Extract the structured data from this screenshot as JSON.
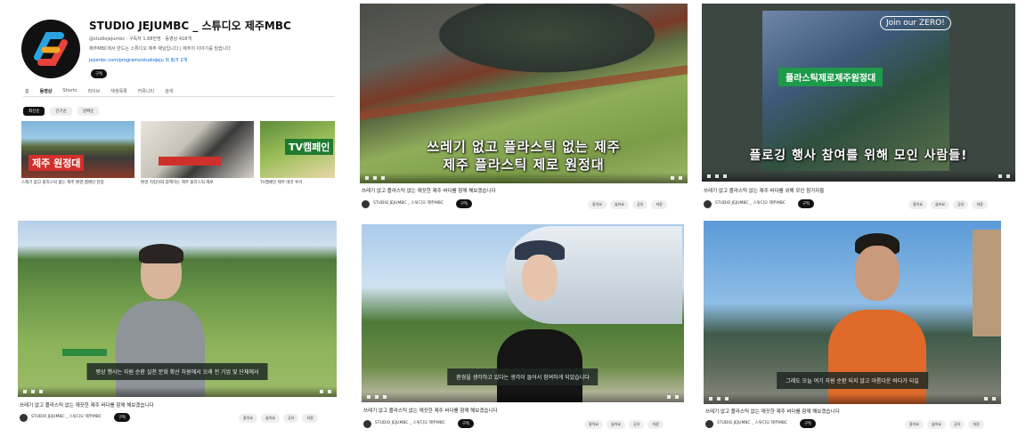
{
  "channel": {
    "name": "STUDIO JEJUMBC _ 스튜디오 제주MBC",
    "handle": "@studiojejumbc · 구독자 1.68만명 · 동영상 418개",
    "desc": "제주MBC에서 만드는 스튜디오 제주 채널입니다 | 제주의 이야기를 담습니다",
    "link": "jejumbc.com/programs/studiojeju 외 링크 2개",
    "subscribe": "구독",
    "tabs": [
      "홈",
      "동영상",
      "Shorts",
      "라이브",
      "재생목록",
      "커뮤니티",
      "검색"
    ],
    "chips": [
      "최신순",
      "인기순",
      "날짜순"
    ],
    "mini": [
      {
        "caption": "스레기 없고 플라스틱 없는 제주 환경 캠페인 현장",
        "overlay": "제주 원정대"
      },
      {
        "caption": "환경 지킴이와 함께하는 제주 플라스틱 제로",
        "overlay": ""
      },
      {
        "caption": "TV캠페인 제주 에코 투어",
        "overlay": "TV캠페인"
      }
    ]
  },
  "videos": [
    {
      "subtitle_l1": "쓰레기 없고 플라스틱 없는 제주",
      "subtitle_l2": "제주 플라스틱 제로 원정대",
      "title": "쓰레기 없고 플라스틱 없는 깨끗한 제주 바다를 함께 해보겠습니다",
      "channel": "STUDIO JEJUMBC _ 스튜디오 제주MBC",
      "views": "조회수 1천회",
      "subscribe": "구독",
      "actions": [
        "좋아요",
        "싫어요",
        "공유",
        "저장"
      ]
    },
    {
      "subtitle_l1": "플로깅 행사 참여를 위해 모인 사람들!",
      "subtitle_l2": "",
      "badge": "플라스틱제로제주원정대",
      "overlay_top": "Join our ZERO!",
      "title": "쓰레기 없고 플라스틱 없는 제주 바다를 위해 모인 참가자들",
      "channel": "STUDIO JEJUMBC _ 스튜디오 제주MBC",
      "views": "조회수 1천회",
      "subscribe": "구독",
      "actions": [
        "좋아요",
        "싫어요",
        "공유",
        "저장"
      ]
    },
    {
      "subtitle_l1": "평상 행사는 자원 순환 실천 문화 확산 차원에서 오래 전 기업 및 단체에서",
      "title": "쓰레기 없고 플라스틱 없는 깨끗한 제주 바다를 함께 해보겠습니다",
      "channel": "STUDIO JEJUMBC _ 스튜디오 제주MBC",
      "views": "조회수 1천회",
      "subscribe": "구독",
      "actions": [
        "좋아요",
        "싫어요",
        "공유",
        "저장"
      ]
    },
    {
      "subtitle_l1": "환경을 생각하고 있다는 생각이 들어서 참여하게 되었습니다",
      "title": "쓰레기 없고 플라스틱 없는 깨끗한 제주 바다를 함께 해보겠습니다",
      "channel": "STUDIO JEJUMBC _ 스튜디오 제주MBC",
      "views": "조회수 1천회",
      "subscribe": "구독",
      "actions": [
        "좋아요",
        "싫어요",
        "공유",
        "저장"
      ]
    },
    {
      "subtitle_l1": "그래도 오늘 여기 자원 순환 되지 않고 아름다운 바다가 되길",
      "title": "쓰레기 없고 플라스틱 없는 깨끗한 제주 바다를 함께 해보겠습니다",
      "channel": "STUDIO JEJUMBC _ 스튜디오 제주MBC",
      "views": "조회수 1천회",
      "subscribe": "구독",
      "actions": [
        "좋아요",
        "싫어요",
        "공유",
        "저장"
      ]
    }
  ]
}
